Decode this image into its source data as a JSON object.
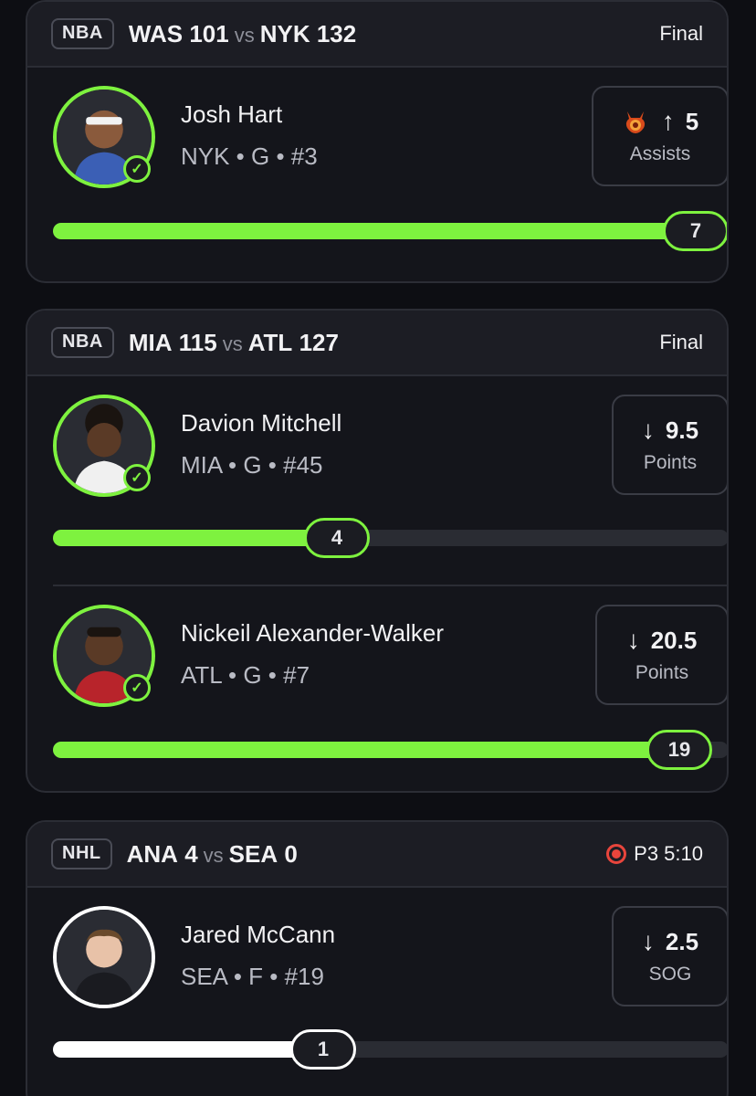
{
  "games": [
    {
      "league": "NBA",
      "away_team": "WAS",
      "away_score": "101",
      "vs": "vs",
      "home_team": "NYK",
      "home_score": "132",
      "status": "Final",
      "players": [
        {
          "name": "Josh Hart",
          "meta": "NYK • G • #3",
          "direction": "up",
          "direction_icon": "↑",
          "line": "5",
          "stat": "Assists",
          "actual": "7",
          "progress_fraction": 1.0,
          "badge": "devil-icon",
          "verified": true
        }
      ]
    },
    {
      "league": "NBA",
      "away_team": "MIA",
      "away_score": "115",
      "vs": "vs",
      "home_team": "ATL",
      "home_score": "127",
      "status": "Final",
      "players": [
        {
          "name": "Davion Mitchell",
          "meta": "MIA • G • #45",
          "direction": "down",
          "direction_icon": "↓",
          "line": "9.5",
          "stat": "Points",
          "actual": "4",
          "progress_fraction": 0.42,
          "verified": true
        },
        {
          "name": "Nickeil Alexander-Walker",
          "meta": "ATL • G • #7",
          "direction": "down",
          "direction_icon": "↓",
          "line": "20.5",
          "stat": "Points",
          "actual": "19",
          "progress_fraction": 0.927,
          "verified": true
        }
      ]
    },
    {
      "league": "NHL",
      "away_team": "ANA",
      "away_score": "4",
      "vs": "vs",
      "home_team": "SEA",
      "home_score": "0",
      "status": "P3 5:10",
      "live": true,
      "players": [
        {
          "name": "Jared McCann",
          "meta": "SEA • F • #19",
          "direction": "down",
          "direction_icon": "↓",
          "line": "2.5",
          "stat": "SOG",
          "actual": "1",
          "progress_fraction": 0.4,
          "verified": false
        }
      ]
    }
  ],
  "colors": {
    "accent": "#7ef23f",
    "live": "#e8453c",
    "background": "#0d0e13",
    "card": "#14151b"
  }
}
